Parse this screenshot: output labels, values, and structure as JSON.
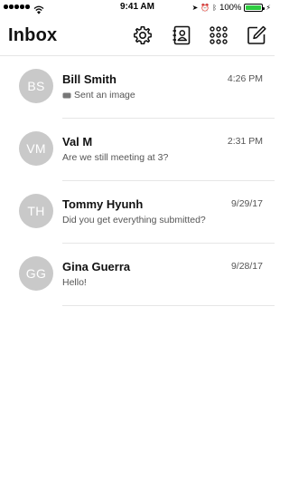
{
  "status_bar": {
    "time": "9:41 AM",
    "battery_percent": "100%",
    "battery_level": 1.0,
    "signal_bars": 5,
    "icons": [
      "signal-icon",
      "wifi-icon",
      "location-icon",
      "alarm-icon",
      "bluetooth-icon",
      "battery-icon",
      "charging-icon"
    ]
  },
  "header": {
    "title": "Inbox",
    "actions": [
      {
        "name": "settings-icon"
      },
      {
        "name": "contacts-icon"
      },
      {
        "name": "apps-grid-icon"
      },
      {
        "name": "compose-icon"
      }
    ]
  },
  "conversations": [
    {
      "initials": "BS",
      "name": "Bill Smith",
      "time": "4:26 PM",
      "preview": "Sent an image",
      "preview_icon": "image-icon"
    },
    {
      "initials": "VM",
      "name": "Val M",
      "time": "2:31 PM",
      "preview": "Are we still meeting at 3?"
    },
    {
      "initials": "TH",
      "name": "Tommy Hyunh",
      "time": "9/29/17",
      "preview": "Did you get everything submitted?"
    },
    {
      "initials": "GG",
      "name": "Gina Guerra",
      "time": "9/28/17",
      "preview": "Hello!"
    }
  ],
  "colors": {
    "avatar_bg": "#c9c9c9",
    "divider": "#e6e6e6",
    "battery": "#2ecc40",
    "text_primary": "#111111",
    "text_secondary": "#555555"
  }
}
